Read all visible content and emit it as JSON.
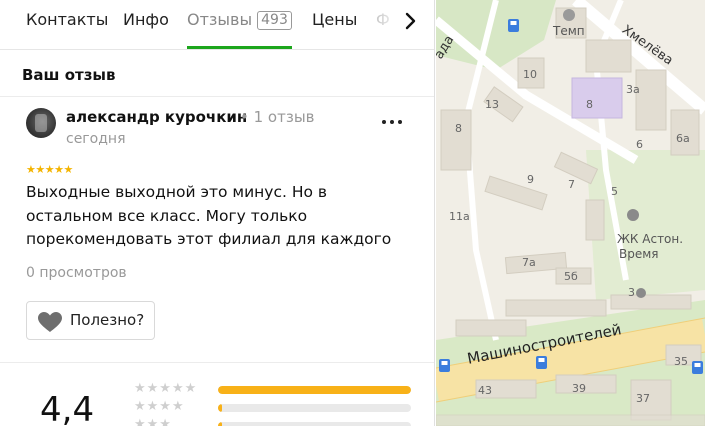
{
  "tabs": {
    "contacts": "Контакты",
    "info": "Инфо",
    "reviews": "Отзывы",
    "reviews_count": "493",
    "prices": "Цены",
    "photos_partial": "Ф"
  },
  "section": {
    "your_review_title": "Ваш отзыв"
  },
  "review": {
    "author": "александр курочкин",
    "author_meta": "• 1 отзыв",
    "date": "сегодня",
    "stars": "★★★★★",
    "rating": 5,
    "text": "Выходные выходной это минус. Но в остальном все класс. Могу только порекомендовать этот филиал для каждого",
    "views": "0 просмотров",
    "helpful_label": "Полезно?"
  },
  "summary": {
    "average": "4,4",
    "distribution": [
      {
        "stars": "★★★★★",
        "fraction": 1.0
      },
      {
        "stars": "★★★★",
        "fraction": 0.02
      },
      {
        "stars": "★★★",
        "fraction": 0.02
      }
    ]
  },
  "map": {
    "street_name": "Машиностроителей",
    "street_hmeleva": "Хмелёва",
    "street_partial": "ада",
    "poi_temp": "Темп",
    "poi_jk": "ЖК Астон.",
    "poi_jk_2": "Время",
    "houses": [
      "10",
      "13",
      "8",
      "3а",
      "8",
      "6",
      "6а",
      "9",
      "7",
      "5",
      "11а",
      "7а",
      "5б",
      "3",
      "35",
      "43",
      "39",
      "37"
    ],
    "colors": {
      "park": "#c9e4b4",
      "road": "#ffffff",
      "road_main": "#f7e3a5",
      "building": "#e2ddd2",
      "highlight": "#d9ccec"
    }
  }
}
